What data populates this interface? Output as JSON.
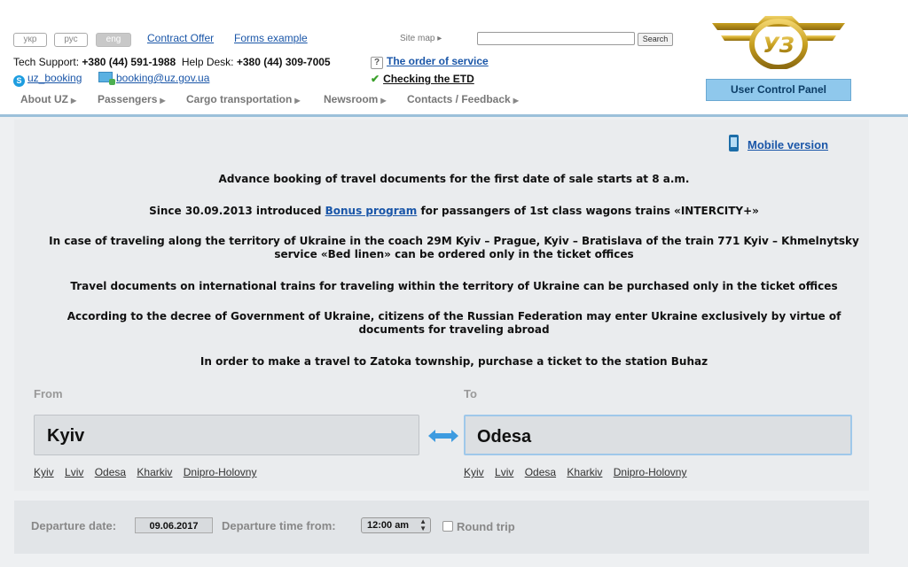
{
  "header": {
    "languages": [
      "укр",
      "рус",
      "eng"
    ],
    "active_language": "eng",
    "links": {
      "contract_offer": "Contract Offer",
      "forms_example": "Forms example"
    },
    "site_map": "Site map ▸",
    "search": {
      "value": "",
      "button_label": "Search"
    },
    "support": {
      "tech_label": "Tech Support:",
      "tech_phone": "+380 (44) 591-1988",
      "help_label": "Help Desk:",
      "help_phone": "+380 (44) 309-7005"
    },
    "skype": "uz_booking",
    "email": "booking@uz.gov.ua",
    "order_of_service": "The order of service",
    "checking_etd": "Checking the ETD",
    "nav": [
      "About UZ",
      "Passengers",
      "Cargo transportation",
      "Newsroom",
      "Contacts / Feedback"
    ],
    "logo_text": "УЗ",
    "user_control_panel": "User Control Panel"
  },
  "mobile_version": "Mobile version",
  "notices": {
    "n1": "Advance booking of travel documents for the first date of sale starts at 8 a.m.",
    "n2_before": "Since 30.09.2013 introduced ",
    "n2_link": "Bonus program",
    "n2_after": " for passangers of 1st class wagons trains «INTERCITY+»",
    "n3_line1": "In case of traveling along the territory of Ukraine in the coach 29M Kyiv – Prague, Kyiv – Bratislava of the train 771 Kyiv – Khmelnytsky",
    "n3_line2": "service «Bed linen» can be ordered only in the ticket offices",
    "n4": "Travel documents on international trains for traveling within the territory of Ukraine can be purchased only in the ticket offices",
    "n5_line1": "According to the decree of Government of Ukraine, citizens of the Russian Federation may enter Ukraine exclusively by virtue of",
    "n5_line2": "documents for traveling abroad",
    "n6": "In order to make a travel to Zatoka township, purchase a ticket to the station Buhaz"
  },
  "search_form": {
    "from_label": "From",
    "to_label": "To",
    "from_value": "Kyiv",
    "to_value": "Odesa",
    "quick_stations": [
      "Kyiv",
      "Lviv",
      "Odesa",
      "Kharkiv",
      "Dnipro-Holovny"
    ],
    "departure_date_label": "Departure date:",
    "departure_date": "09.06.2017",
    "departure_time_label": "Departure time from:",
    "departure_time": "12:00 am",
    "round_trip_label": "Round trip",
    "round_trip_checked": false
  },
  "colors": {
    "link": "#1a56a8",
    "header_border": "#9cc0da",
    "user_panel_bg": "#8fc8ec",
    "logo_gold": "#c8a020",
    "swap_arrow": "#3d9be0"
  },
  "icons": [
    "skype-icon",
    "mail-icon",
    "question-icon",
    "checkmark-icon",
    "phone-icon",
    "swap-arrows-icon",
    "chevron-right-icon"
  ]
}
